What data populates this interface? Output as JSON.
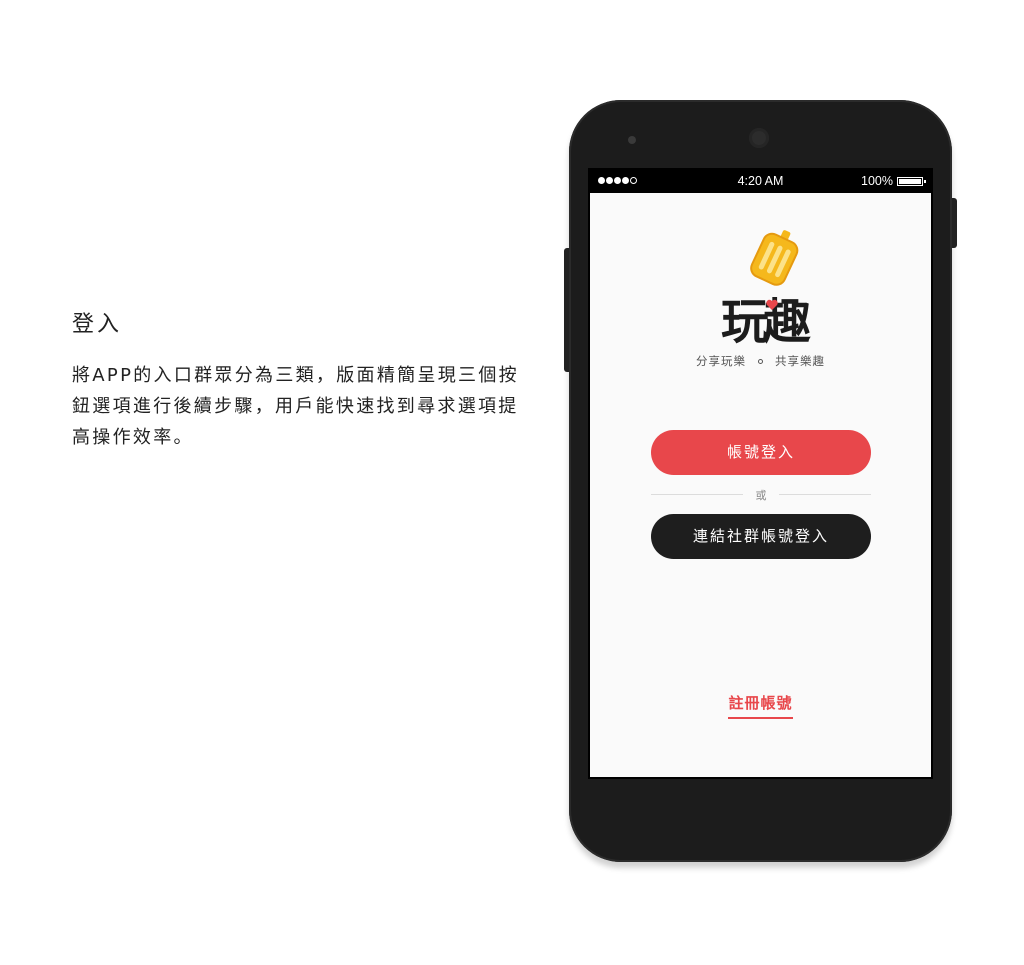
{
  "description": {
    "title": "登入",
    "body": "將APP的入口群眾分為三類，版面精簡呈現三個按鈕選項進行後續步驟，用戶能快速找到尋求選項提高操作效率。"
  },
  "status_bar": {
    "time": "4:20 AM",
    "battery": "100%"
  },
  "app": {
    "logo_text": "玩趣",
    "tagline_left": "分享玩樂",
    "tagline_right": "共享樂趣",
    "login_button": "帳號登入",
    "or_text": "或",
    "social_button": "連結社群帳號登入",
    "register_link": "註冊帳號"
  },
  "colors": {
    "accent": "#e8474b",
    "dark_button": "#1e1e1e",
    "logo_suitcase": "#f5b81c"
  },
  "icons": [
    "signal-dots-icon",
    "battery-icon",
    "suitcase-icon",
    "heart-icon"
  ]
}
